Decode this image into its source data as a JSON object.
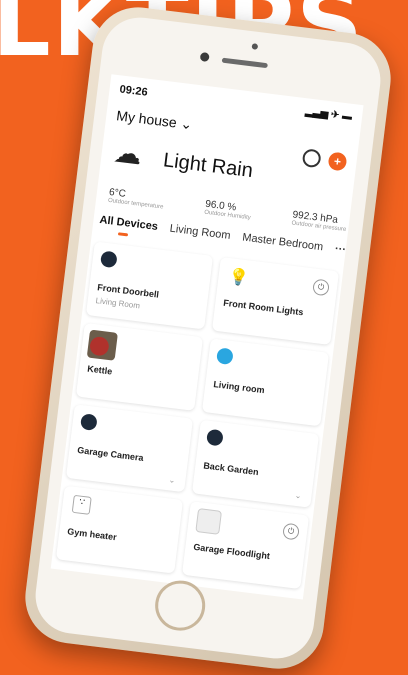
{
  "headline": "LKTIPS",
  "status": {
    "time": "09:26",
    "icons": "▂▃▅ ✈ ▬"
  },
  "header": {
    "house": "My house ⌄",
    "camera_icon": "camera-icon",
    "add_icon": "+"
  },
  "weather": {
    "icon": "☁",
    "condition": "Light Rain",
    "stats": [
      {
        "value": "6°C",
        "label": "Outdoor temperature"
      },
      {
        "value": "96.0 %",
        "label": "Outdoor Humidity"
      },
      {
        "value": "992.3 hPa",
        "label": "Outdoor air pressure"
      }
    ]
  },
  "tabs": [
    "All Devices",
    "Living Room",
    "Master Bedroom",
    "···"
  ],
  "devices": [
    {
      "name": "Front Doorbell",
      "sub": "Living Room",
      "icon": "doorbell-icon"
    },
    {
      "name": "Front Room Lights",
      "sub": "",
      "icon": "bulb-icon",
      "power": "⏻"
    },
    {
      "name": "Kettle",
      "sub": "",
      "icon": "kettle-photo"
    },
    {
      "name": "Living room",
      "sub": "",
      "icon": "camera-icon"
    },
    {
      "name": "Garage Camera",
      "sub": "",
      "icon": "camera-icon",
      "chev": "⌄"
    },
    {
      "name": "Back Garden",
      "sub": "",
      "icon": "camera-icon",
      "chev": "⌄"
    },
    {
      "name": "Gym heater",
      "sub": "",
      "icon": "plug-icon"
    },
    {
      "name": "Garage Floodlight",
      "sub": "",
      "icon": "floodlight-icon",
      "power": "⏻"
    }
  ]
}
